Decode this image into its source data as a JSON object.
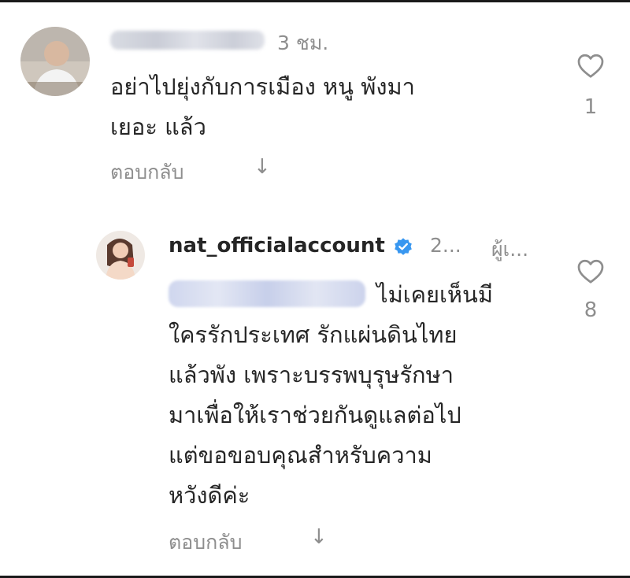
{
  "comments": [
    {
      "time": "3 ชม.",
      "text": "อย่าไปยุ่งกับการเมือง หนู พังมา\nเยอะ แล้ว",
      "reply_label": "ตอบกลับ",
      "likes": "1"
    },
    {
      "username": "nat_officialaccount",
      "time": "2...",
      "author_label": "ผู้เ...",
      "text": "ไม่เคยเห็นมี\nใครรักประเทศ รักแผ่นดินไทย\nแล้วพัง เพราะบรรพบุรุษรักษา\nมาเพื่อให้เราช่วยกันดูแลต่อไป\nแต่ขอขอบคุณสำหรับความ\nหวังดีค่ะ",
      "reply_label": "ตอบกลับ",
      "likes": "8"
    }
  ],
  "icons": {
    "like": "heart-outline-icon",
    "translate": "down-arrow-icon",
    "verified": "verified-badge-icon"
  },
  "colors": {
    "verified": "#3897f0",
    "secondary_text": "#8e8e8e"
  }
}
